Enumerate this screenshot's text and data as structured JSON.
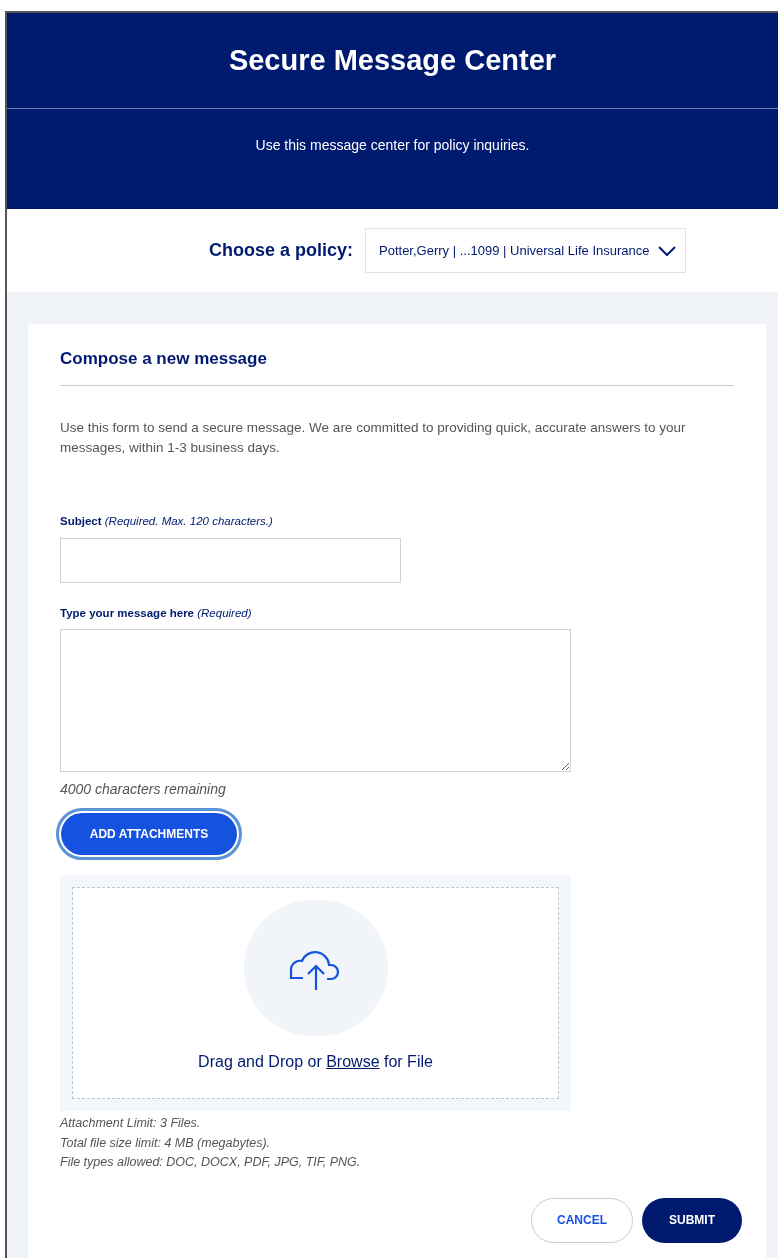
{
  "header": {
    "title": "Secure Message Center",
    "subtitle": "Use this message center for policy inquiries."
  },
  "policy": {
    "label": "Choose a policy:",
    "value": "Potter,Gerry | ...1099 | Universal Life Insurance"
  },
  "compose": {
    "heading": "Compose a new message",
    "intro": "Use this form to send a secure message. We are committed to providing quick, accurate answers to your messages, within 1-3 business days.",
    "subject": {
      "label": "Subject",
      "hint": "(Required. Max. 120 characters.)"
    },
    "message": {
      "label": "Type your message here",
      "hint": "(Required)"
    },
    "counter": "4000 characters remaining",
    "attach_button": {
      "label": "ADD ATTACHMENTS",
      "focused": true
    },
    "dropzone": {
      "before": "Drag and Drop or",
      "link": "Browse",
      "after": "for File"
    },
    "notes": [
      "Attachment Limit: 3 Files.",
      "Total file size limit: 4 MB (megabytes).",
      "File types allowed: DOC, DOCX, PDF, JPG, TIF, PNG."
    ],
    "buttons": [
      {
        "label": "CANCEL",
        "kind": "secondary"
      },
      {
        "label": "SUBMIT",
        "kind": "primary"
      }
    ]
  }
}
